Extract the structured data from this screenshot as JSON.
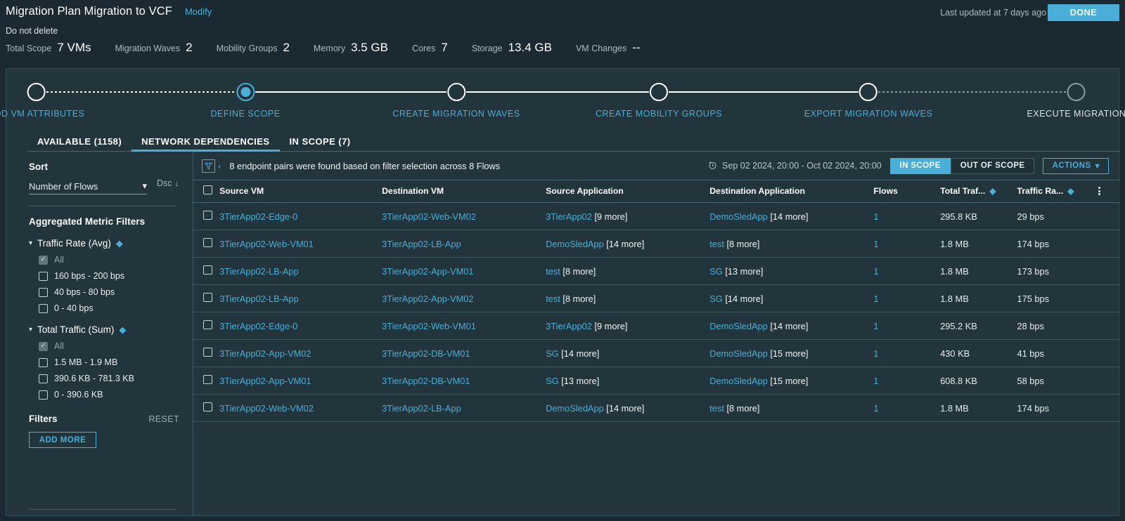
{
  "header": {
    "plan_title": "Migration Plan Migration to VCF",
    "modify_label": "Modify",
    "subtitle": "Do not delete",
    "last_updated": "Last updated at 7 days ago",
    "done_label": "DONE",
    "metrics": [
      {
        "label": "Total Scope",
        "value": "7 VMs"
      },
      {
        "label": "Migration Waves",
        "value": "2"
      },
      {
        "label": "Mobility Groups",
        "value": "2"
      },
      {
        "label": "Memory",
        "value": "3.5 GB"
      },
      {
        "label": "Cores",
        "value": "7"
      },
      {
        "label": "Storage",
        "value": "13.4 GB"
      },
      {
        "label": "VM Changes",
        "value": "--"
      }
    ]
  },
  "stepper": {
    "steps": [
      {
        "label": "ADD VM ATTRIBUTES",
        "state": "done"
      },
      {
        "label": "DEFINE SCOPE",
        "state": "current"
      },
      {
        "label": "CREATE MIGRATION WAVES",
        "state": "done"
      },
      {
        "label": "CREATE MOBILITY GROUPS",
        "state": "done"
      },
      {
        "label": "EXPORT MIGRATION WAVES",
        "state": "done"
      },
      {
        "label": "EXECUTE MIGRATION",
        "state": "pending"
      }
    ]
  },
  "tabs": [
    {
      "label": "AVAILABLE (1158)",
      "active": false
    },
    {
      "label": "NETWORK DEPENDENCIES",
      "active": true
    },
    {
      "label": "IN SCOPE (7)",
      "active": false
    }
  ],
  "sidebar": {
    "sort_title": "Sort",
    "sort_value": "Number of Flows",
    "sort_direction": "Dsc",
    "aggregated_title": "Aggregated Metric Filters",
    "groups": [
      {
        "title": "Traffic Rate (Avg)",
        "options": [
          {
            "label": "All",
            "checked": true,
            "dim": true
          },
          {
            "label": "160 bps - 200 bps",
            "checked": false,
            "dim": false
          },
          {
            "label": "40 bps - 80 bps",
            "checked": false,
            "dim": false
          },
          {
            "label": "0 - 40 bps",
            "checked": false,
            "dim": false
          }
        ]
      },
      {
        "title": "Total Traffic (Sum)",
        "options": [
          {
            "label": "All",
            "checked": true,
            "dim": true
          },
          {
            "label": "1.5 MB - 1.9 MB",
            "checked": false,
            "dim": false
          },
          {
            "label": "390.6 KB - 781.3 KB",
            "checked": false,
            "dim": false
          },
          {
            "label": "0 - 390.6 KB",
            "checked": false,
            "dim": false
          }
        ]
      }
    ],
    "filters_title": "Filters",
    "reset_label": "RESET",
    "add_more_label": "ADD MORE"
  },
  "toolbar": {
    "filter_icon": "funnel-icon",
    "collapse_icon": "chevron-left-icon",
    "found_text": "8 endpoint pairs were found based on filter selection across 8 Flows",
    "date_icon": "clock-history-icon",
    "date_range": "Sep 02 2024, 20:00 - Oct 02 2024, 20:00",
    "scope_in_label": "IN SCOPE",
    "scope_out_label": "OUT OF SCOPE",
    "scope_selected": "IN SCOPE",
    "actions_label": "ACTIONS"
  },
  "table": {
    "columns": [
      "Source VM",
      "Destination VM",
      "Source Application",
      "Destination Application",
      "Flows",
      "Total Traf...",
      "Traffic Ra..."
    ],
    "rows": [
      {
        "source_vm": "3TierApp02-Edge-0",
        "destination_vm": "3TierApp02-Web-VM02",
        "source_app": "3TierApp02",
        "source_more": "[9 more]",
        "dest_app": "DemoSledApp",
        "dest_more": "[14 more]",
        "flows": "1",
        "total_traffic": "295.8 KB",
        "traffic_rate": "29 bps"
      },
      {
        "source_vm": "3TierApp02-Web-VM01",
        "destination_vm": "3TierApp02-LB-App",
        "source_app": "DemoSledApp",
        "source_more": "[14 more]",
        "dest_app": "test",
        "dest_more": "[8 more]",
        "flows": "1",
        "total_traffic": "1.8 MB",
        "traffic_rate": "174 bps"
      },
      {
        "source_vm": "3TierApp02-LB-App",
        "destination_vm": "3TierApp02-App-VM01",
        "source_app": "test",
        "source_more": "[8 more]",
        "dest_app": "SG",
        "dest_more": "[13 more]",
        "flows": "1",
        "total_traffic": "1.8 MB",
        "traffic_rate": "173 bps"
      },
      {
        "source_vm": "3TierApp02-LB-App",
        "destination_vm": "3TierApp02-App-VM02",
        "source_app": "test",
        "source_more": "[8 more]",
        "dest_app": "SG",
        "dest_more": "[14 more]",
        "flows": "1",
        "total_traffic": "1.8 MB",
        "traffic_rate": "175 bps"
      },
      {
        "source_vm": "3TierApp02-Edge-0",
        "destination_vm": "3TierApp02-Web-VM01",
        "source_app": "3TierApp02",
        "source_more": "[9 more]",
        "dest_app": "DemoSledApp",
        "dest_more": "[14 more]",
        "flows": "1",
        "total_traffic": "295.2 KB",
        "traffic_rate": "28 bps"
      },
      {
        "source_vm": "3TierApp02-App-VM02",
        "destination_vm": "3TierApp02-DB-VM01",
        "source_app": "SG",
        "source_more": "[14 more]",
        "dest_app": "DemoSledApp",
        "dest_more": "[15 more]",
        "flows": "1",
        "total_traffic": "430 KB",
        "traffic_rate": "41 bps"
      },
      {
        "source_vm": "3TierApp02-App-VM01",
        "destination_vm": "3TierApp02-DB-VM01",
        "source_app": "SG",
        "source_more": "[13 more]",
        "dest_app": "DemoSledApp",
        "dest_more": "[15 more]",
        "flows": "1",
        "total_traffic": "608.8 KB",
        "traffic_rate": "58 bps"
      },
      {
        "source_vm": "3TierApp02-Web-VM02",
        "destination_vm": "3TierApp02-LB-App",
        "source_app": "DemoSledApp",
        "source_more": "[14 more]",
        "dest_app": "test",
        "dest_more": "[8 more]",
        "flows": "1",
        "total_traffic": "1.8 MB",
        "traffic_rate": "174 bps"
      }
    ]
  },
  "colors": {
    "accent": "#49afd9",
    "page_bg": "#1b2a32",
    "panel_bg": "#22343c",
    "border": "#3f5c68"
  }
}
